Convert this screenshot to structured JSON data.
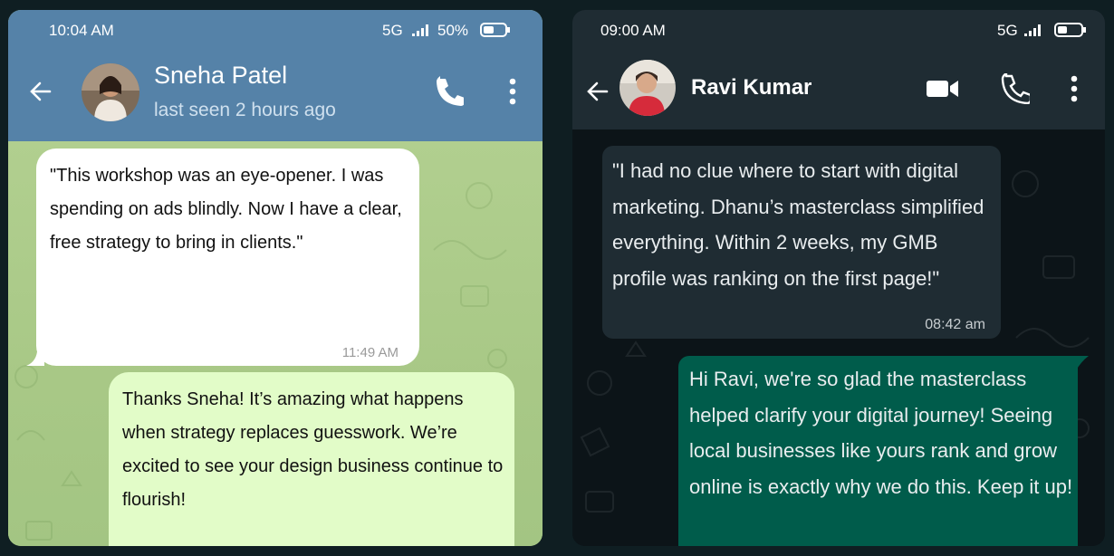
{
  "phone_left": {
    "status_bar": {
      "time": "10:04 AM",
      "network": "5G",
      "battery": "50%"
    },
    "contact": {
      "name": "Sneha Patel",
      "status": "last seen 2 hours ago"
    },
    "messages": [
      {
        "direction": "incoming",
        "text": "\"This workshop was an eye-opener. I was spending on ads blindly. Now I have a clear, free strategy to bring in clients.\"",
        "time": "11:49 AM"
      },
      {
        "direction": "outgoing",
        "text": "Thanks Sneha! It’s amazing what happens when strategy replaces guesswork. We’re excited to see your design business continue to flourish!"
      }
    ],
    "colors": {
      "header": "#5582a8",
      "chat_background": "#a9c987",
      "incoming_bubble": "#ffffff",
      "outgoing_bubble": "#e2fcc8"
    }
  },
  "phone_right": {
    "status_bar": {
      "time": "09:00 AM",
      "network": "5G"
    },
    "contact": {
      "name": "Ravi Kumar"
    },
    "messages": [
      {
        "direction": "incoming",
        "text": " \"I had no clue where to start with digital marketing. Dhanu’s masterclass simplified everything. Within 2 weeks, my GMB profile was ranking on the first page!\"",
        "time": "08:42 am"
      },
      {
        "direction": "outgoing",
        "text": "Hi Ravi, we're so glad the masterclass helped clarify your digital journey! Seeing local businesses like yours rank and grow online is exactly why we do this. Keep it up!"
      }
    ],
    "colors": {
      "header": "#1f2c33",
      "chat_background": "#0c1418",
      "incoming_bubble": "#1f2c33",
      "outgoing_bubble": "#005c4b"
    }
  },
  "icons": [
    "back-arrow-icon",
    "phone-call-icon",
    "video-call-icon",
    "more-vertical-icon",
    "signal-icon",
    "battery-icon"
  ]
}
